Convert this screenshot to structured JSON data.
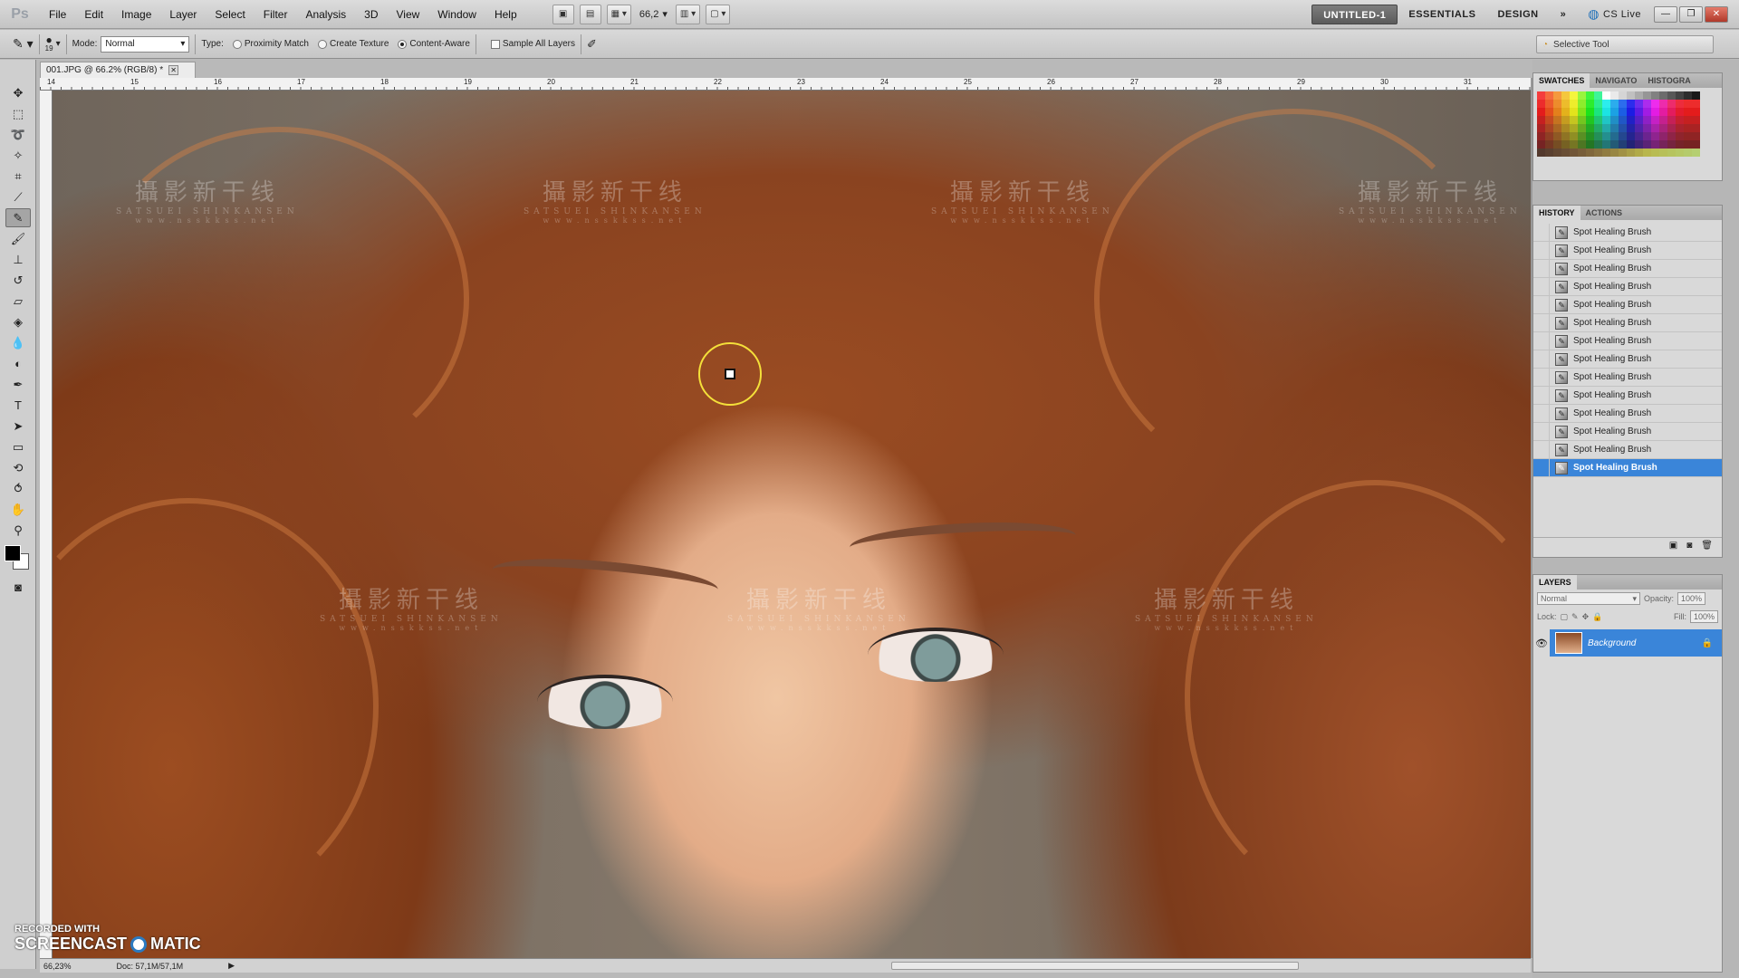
{
  "app": {
    "logo": "Ps"
  },
  "menu": [
    "File",
    "Edit",
    "Image",
    "Layer",
    "Select",
    "Filter",
    "Analysis",
    "3D",
    "View",
    "Window",
    "Help"
  ],
  "menubar": {
    "zoom": "66,2",
    "workspaces": [
      "UNTITLED-1",
      "ESSENTIALS",
      "DESIGN"
    ],
    "more": "»",
    "cslive": "CS Live"
  },
  "options": {
    "brush_size": "19",
    "mode_label": "Mode:",
    "mode_value": "Normal",
    "type_label": "Type:",
    "proximity": "Proximity Match",
    "create_texture": "Create Texture",
    "content_aware": "Content-Aware",
    "sample_all": "Sample All Layers",
    "selective_tool": "Selective Tool"
  },
  "document": {
    "tab": "001.JPG @ 66.2% (RGB/8) *",
    "ruler_numbers": [
      "14",
      "15",
      "16",
      "17",
      "18",
      "19",
      "20",
      "21",
      "22",
      "23",
      "24",
      "25",
      "26",
      "27",
      "28",
      "29",
      "30",
      "31"
    ],
    "watermark_main": "攝影新干线",
    "watermark_sub": "SATSUEI SHINKANSEN",
    "watermark_url": "www.nsskkss.net"
  },
  "status": {
    "zoom": "66,23%",
    "doc": "Doc: 57,1M/57,1M"
  },
  "screencast": {
    "recorded": "RECORDED WITH",
    "brand_left": "SCREENCAST",
    "brand_right": "MATIC"
  },
  "panels": {
    "swatch_tabs": [
      "SWATCHES",
      "NAVIGATO",
      "HISTOGRA"
    ],
    "history_tabs": [
      "HISTORY",
      "ACTIONS"
    ],
    "history_items": [
      "Spot Healing Brush",
      "Spot Healing Brush",
      "Spot Healing Brush",
      "Spot Healing Brush",
      "Spot Healing Brush",
      "Spot Healing Brush",
      "Spot Healing Brush",
      "Spot Healing Brush",
      "Spot Healing Brush",
      "Spot Healing Brush",
      "Spot Healing Brush",
      "Spot Healing Brush",
      "Spot Healing Brush",
      "Spot Healing Brush"
    ],
    "history_active_index": 13,
    "layers_tab": "LAYERS",
    "blend_mode": "Normal",
    "opacity_label": "Opacity:",
    "opacity": "100%",
    "lock_label": "Lock:",
    "fill_label": "Fill:",
    "fill": "100%",
    "layer_name": "Background"
  },
  "colors": {
    "accent": "#3a85d9",
    "cursor": "#f4e03a"
  }
}
